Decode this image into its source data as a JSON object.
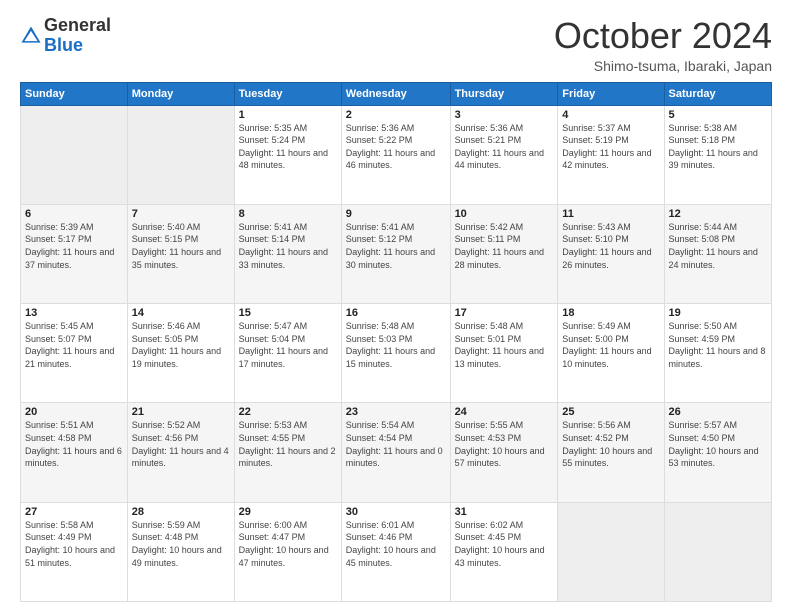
{
  "logo": {
    "general": "General",
    "blue": "Blue"
  },
  "header": {
    "month": "October 2024",
    "location": "Shimo-tsuma, Ibaraki, Japan"
  },
  "days_of_week": [
    "Sunday",
    "Monday",
    "Tuesday",
    "Wednesday",
    "Thursday",
    "Friday",
    "Saturday"
  ],
  "weeks": [
    [
      {
        "day": "",
        "info": ""
      },
      {
        "day": "",
        "info": ""
      },
      {
        "day": "1",
        "info": "Sunrise: 5:35 AM\nSunset: 5:24 PM\nDaylight: 11 hours and 48 minutes."
      },
      {
        "day": "2",
        "info": "Sunrise: 5:36 AM\nSunset: 5:22 PM\nDaylight: 11 hours and 46 minutes."
      },
      {
        "day": "3",
        "info": "Sunrise: 5:36 AM\nSunset: 5:21 PM\nDaylight: 11 hours and 44 minutes."
      },
      {
        "day": "4",
        "info": "Sunrise: 5:37 AM\nSunset: 5:19 PM\nDaylight: 11 hours and 42 minutes."
      },
      {
        "day": "5",
        "info": "Sunrise: 5:38 AM\nSunset: 5:18 PM\nDaylight: 11 hours and 39 minutes."
      }
    ],
    [
      {
        "day": "6",
        "info": "Sunrise: 5:39 AM\nSunset: 5:17 PM\nDaylight: 11 hours and 37 minutes."
      },
      {
        "day": "7",
        "info": "Sunrise: 5:40 AM\nSunset: 5:15 PM\nDaylight: 11 hours and 35 minutes."
      },
      {
        "day": "8",
        "info": "Sunrise: 5:41 AM\nSunset: 5:14 PM\nDaylight: 11 hours and 33 minutes."
      },
      {
        "day": "9",
        "info": "Sunrise: 5:41 AM\nSunset: 5:12 PM\nDaylight: 11 hours and 30 minutes."
      },
      {
        "day": "10",
        "info": "Sunrise: 5:42 AM\nSunset: 5:11 PM\nDaylight: 11 hours and 28 minutes."
      },
      {
        "day": "11",
        "info": "Sunrise: 5:43 AM\nSunset: 5:10 PM\nDaylight: 11 hours and 26 minutes."
      },
      {
        "day": "12",
        "info": "Sunrise: 5:44 AM\nSunset: 5:08 PM\nDaylight: 11 hours and 24 minutes."
      }
    ],
    [
      {
        "day": "13",
        "info": "Sunrise: 5:45 AM\nSunset: 5:07 PM\nDaylight: 11 hours and 21 minutes."
      },
      {
        "day": "14",
        "info": "Sunrise: 5:46 AM\nSunset: 5:05 PM\nDaylight: 11 hours and 19 minutes."
      },
      {
        "day": "15",
        "info": "Sunrise: 5:47 AM\nSunset: 5:04 PM\nDaylight: 11 hours and 17 minutes."
      },
      {
        "day": "16",
        "info": "Sunrise: 5:48 AM\nSunset: 5:03 PM\nDaylight: 11 hours and 15 minutes."
      },
      {
        "day": "17",
        "info": "Sunrise: 5:48 AM\nSunset: 5:01 PM\nDaylight: 11 hours and 13 minutes."
      },
      {
        "day": "18",
        "info": "Sunrise: 5:49 AM\nSunset: 5:00 PM\nDaylight: 11 hours and 10 minutes."
      },
      {
        "day": "19",
        "info": "Sunrise: 5:50 AM\nSunset: 4:59 PM\nDaylight: 11 hours and 8 minutes."
      }
    ],
    [
      {
        "day": "20",
        "info": "Sunrise: 5:51 AM\nSunset: 4:58 PM\nDaylight: 11 hours and 6 minutes."
      },
      {
        "day": "21",
        "info": "Sunrise: 5:52 AM\nSunset: 4:56 PM\nDaylight: 11 hours and 4 minutes."
      },
      {
        "day": "22",
        "info": "Sunrise: 5:53 AM\nSunset: 4:55 PM\nDaylight: 11 hours and 2 minutes."
      },
      {
        "day": "23",
        "info": "Sunrise: 5:54 AM\nSunset: 4:54 PM\nDaylight: 11 hours and 0 minutes."
      },
      {
        "day": "24",
        "info": "Sunrise: 5:55 AM\nSunset: 4:53 PM\nDaylight: 10 hours and 57 minutes."
      },
      {
        "day": "25",
        "info": "Sunrise: 5:56 AM\nSunset: 4:52 PM\nDaylight: 10 hours and 55 minutes."
      },
      {
        "day": "26",
        "info": "Sunrise: 5:57 AM\nSunset: 4:50 PM\nDaylight: 10 hours and 53 minutes."
      }
    ],
    [
      {
        "day": "27",
        "info": "Sunrise: 5:58 AM\nSunset: 4:49 PM\nDaylight: 10 hours and 51 minutes."
      },
      {
        "day": "28",
        "info": "Sunrise: 5:59 AM\nSunset: 4:48 PM\nDaylight: 10 hours and 49 minutes."
      },
      {
        "day": "29",
        "info": "Sunrise: 6:00 AM\nSunset: 4:47 PM\nDaylight: 10 hours and 47 minutes."
      },
      {
        "day": "30",
        "info": "Sunrise: 6:01 AM\nSunset: 4:46 PM\nDaylight: 10 hours and 45 minutes."
      },
      {
        "day": "31",
        "info": "Sunrise: 6:02 AM\nSunset: 4:45 PM\nDaylight: 10 hours and 43 minutes."
      },
      {
        "day": "",
        "info": ""
      },
      {
        "day": "",
        "info": ""
      }
    ]
  ]
}
